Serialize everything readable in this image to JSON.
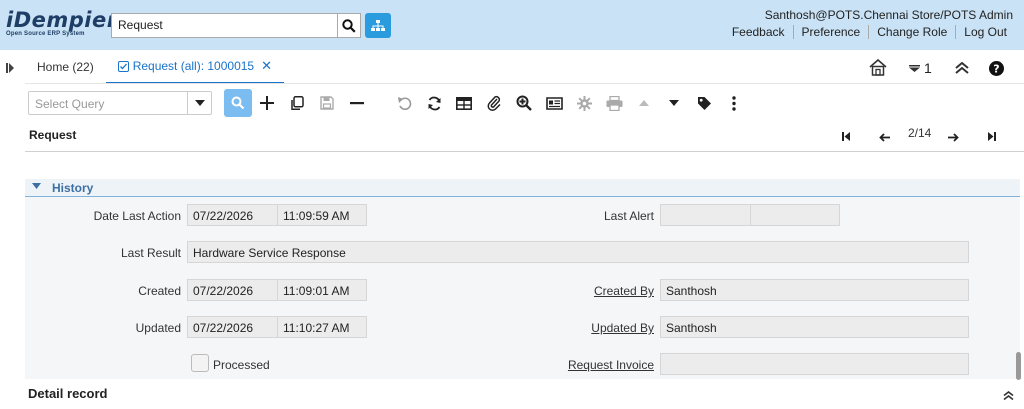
{
  "app": {
    "logo_text": "iDempiere",
    "logo_subtext": "Open Source ERP System"
  },
  "header": {
    "search_value": "Request",
    "user_info": "Santhosh@POTS.Chennai Store/POTS Admin",
    "links": [
      "Feedback",
      "Preference",
      "Change Role",
      "Log Out"
    ]
  },
  "tabs": {
    "home": "Home (22)",
    "active": "Request (all): 1000015",
    "window_count": "1"
  },
  "toolbar": {
    "query_placeholder": "Select Query"
  },
  "window": {
    "title": "Request",
    "record_nav": "2/14"
  },
  "history": {
    "section_label": "History",
    "date_last_action_label": "Date Last Action",
    "date_last_action_date": "07/22/2026",
    "date_last_action_time": "11:09:59 AM",
    "last_alert_label": "Last Alert",
    "last_alert_date": "",
    "last_alert_time": "",
    "last_result_label": "Last Result",
    "last_result_value": "Hardware Service Response",
    "created_label": "Created",
    "created_date": "07/22/2026",
    "created_time": "11:09:01 AM",
    "created_by_label": "Created By",
    "created_by_value": "Santhosh",
    "updated_label": "Updated",
    "updated_date": "07/22/2026",
    "updated_time": "11:10:27 AM",
    "updated_by_label": "Updated By",
    "updated_by_value": "Santhosh",
    "processed_label": "Processed",
    "processed_checked": false,
    "request_invoice_label": "Request Invoice",
    "request_invoice_value": ""
  },
  "detail": {
    "label": "Detail record"
  },
  "colors": {
    "header_bg": "#c9e2f5",
    "accent": "#1a73c8",
    "button_blue": "#2a9bdc",
    "section_blue": "#3c6fa3"
  }
}
